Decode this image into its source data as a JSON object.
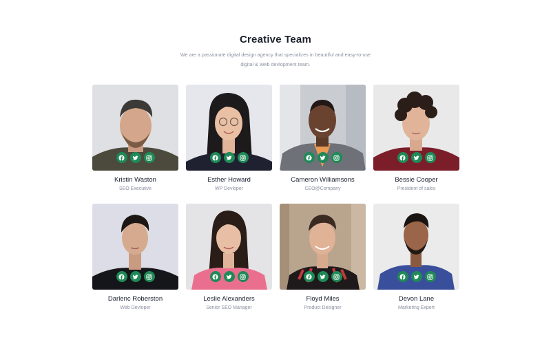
{
  "header": {
    "title": "Creative Team",
    "subtitle": "We are a passionate digital design agency that specializes in beautiful and easy-to-use digital & Web devlopment team."
  },
  "members": [
    {
      "name": "Kristin Waston",
      "role": "SEO Executive"
    },
    {
      "name": "Esther Howard",
      "role": "WP Devloper"
    },
    {
      "name": "Cameron Williamsons",
      "role": "CEO@Company"
    },
    {
      "name": "Bessie Cooper",
      "role": "President of sales"
    },
    {
      "name": "Darlenc Roberston",
      "role": "Web Devloper"
    },
    {
      "name": "Leslie Alexanders",
      "role": "Senior SEO Manager"
    },
    {
      "name": "Floyd Miles",
      "role": "Product Designer"
    },
    {
      "name": "Devon Lane",
      "role": "Marketing Expert"
    }
  ],
  "social_icons": [
    "facebook-icon",
    "twitter-icon",
    "instagram-icon"
  ],
  "colors": {
    "accent": "#1f8a57",
    "title": "#1b1f2a",
    "muted": "#8b90a0"
  }
}
